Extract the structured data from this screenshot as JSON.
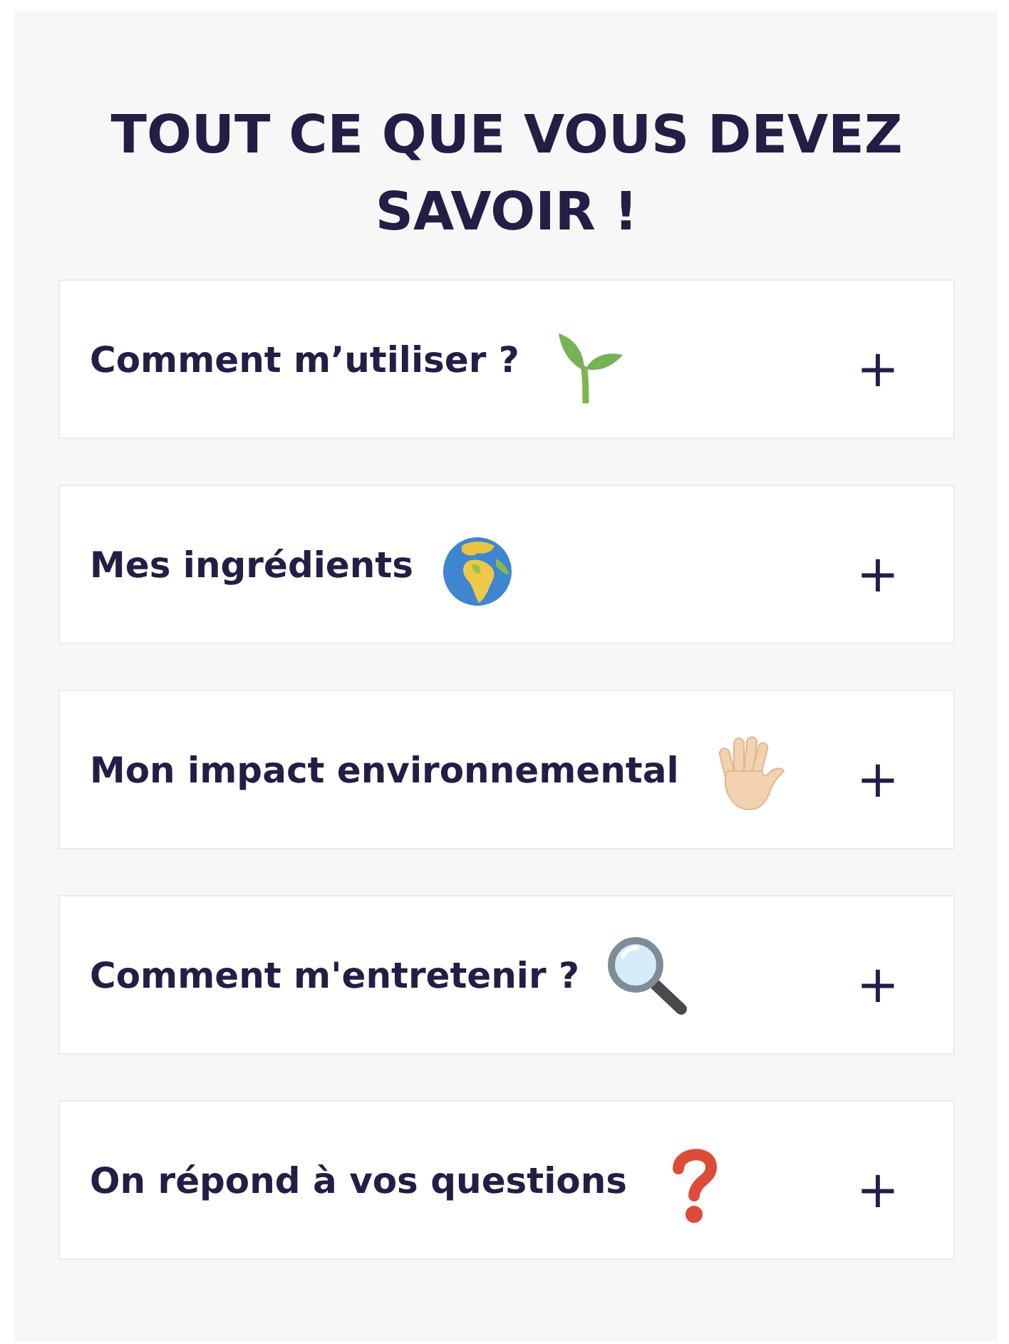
{
  "section": {
    "title": "TOUT CE QUE VOUS DEVEZ SAVOIR !"
  },
  "items": [
    {
      "kind": "seedling",
      "question": "Comment m’utiliser ?",
      "toggle": "+"
    },
    {
      "kind": "globe",
      "question": "Mes ingrédients",
      "toggle": "+"
    },
    {
      "kind": "hand",
      "question": "Mon impact environnemental",
      "toggle": "+"
    },
    {
      "kind": "magnifier",
      "question": "Comment m'entretenir ?",
      "toggle": "+"
    },
    {
      "kind": "question",
      "question": "On répond à vos questions",
      "toggle": "+"
    }
  ]
}
